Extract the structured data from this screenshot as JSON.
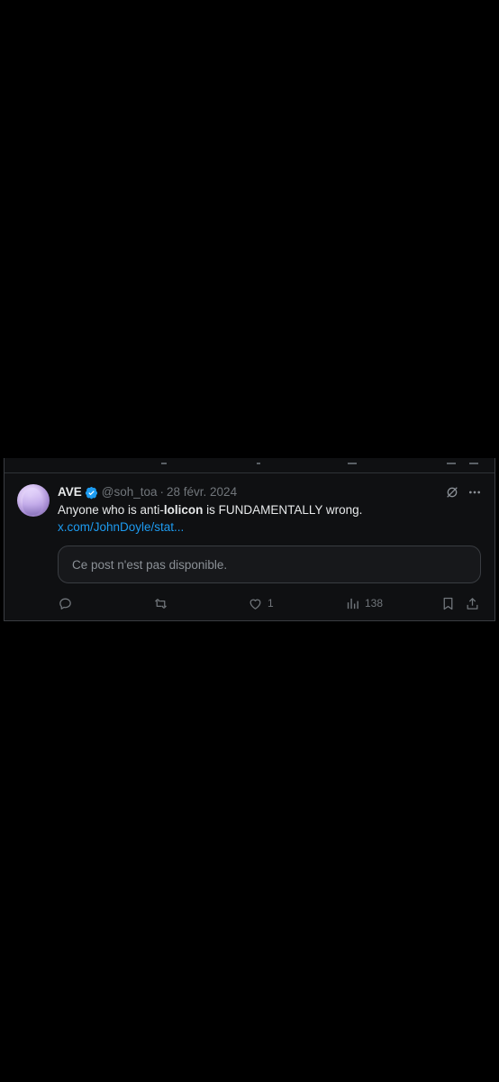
{
  "tweet": {
    "display_name": "AVE",
    "verified": true,
    "handle": "@soh_toa",
    "separator": "·",
    "date": "28 févr. 2024",
    "text_before": "Anyone who is anti-",
    "text_bold": "lolicon",
    "text_after": " is FUNDAMENTALLY wrong.",
    "link_text": "x.com/JohnDoyle/stat...",
    "quoted_unavailable": "Ce post n'est pas disponible.",
    "actions": {
      "reply_count": "",
      "repost_count": "",
      "like_count": "1",
      "views_count": "138"
    }
  },
  "icons": {
    "verified": "verified-badge-icon",
    "grok": "grok-icon",
    "more": "more-icon",
    "reply": "reply-icon",
    "repost": "repost-icon",
    "like": "heart-icon",
    "views": "views-icon",
    "bookmark": "bookmark-icon",
    "share": "share-icon"
  },
  "colors": {
    "background": "#000000",
    "text": "#e7e9ea",
    "secondary_text": "#71767b",
    "link": "#1d9bf0",
    "verified": "#1d9bf0"
  }
}
